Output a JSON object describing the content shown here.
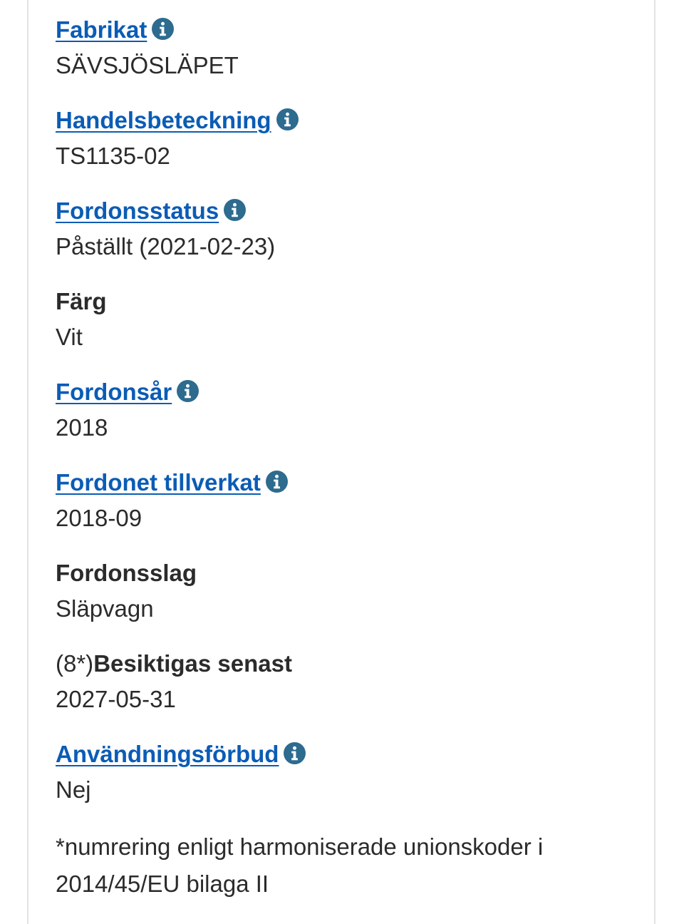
{
  "fields": [
    {
      "label": "Fabrikat",
      "value": "SÄVSJÖSLÄPET"
    },
    {
      "label": "Handelsbeteckning",
      "value": "TS1135-02"
    },
    {
      "label": "Fordonsstatus",
      "value": "Påställt (2021-02-23)"
    },
    {
      "label": "Färg",
      "value": "Vit"
    },
    {
      "label": "Fordonsår",
      "value": "2018"
    },
    {
      "label": "Fordonet tillverkat",
      "value": "2018-09"
    },
    {
      "label": "Fordonsslag",
      "value": "Släpvagn"
    },
    {
      "label_prefix": "(8*)",
      "label": "Besiktigas senast",
      "value": "2027-05-31"
    },
    {
      "label": "Användningsförbud",
      "value": "Nej"
    }
  ],
  "footnote": "*numrering enligt harmoniserade unionskoder i 2014/45/EU bilaga II",
  "colors": {
    "link": "#0b5cb5",
    "info_icon": "#2d6b8f",
    "text": "#2b2b2b"
  },
  "icons": {
    "info": "info-circle-icon"
  }
}
